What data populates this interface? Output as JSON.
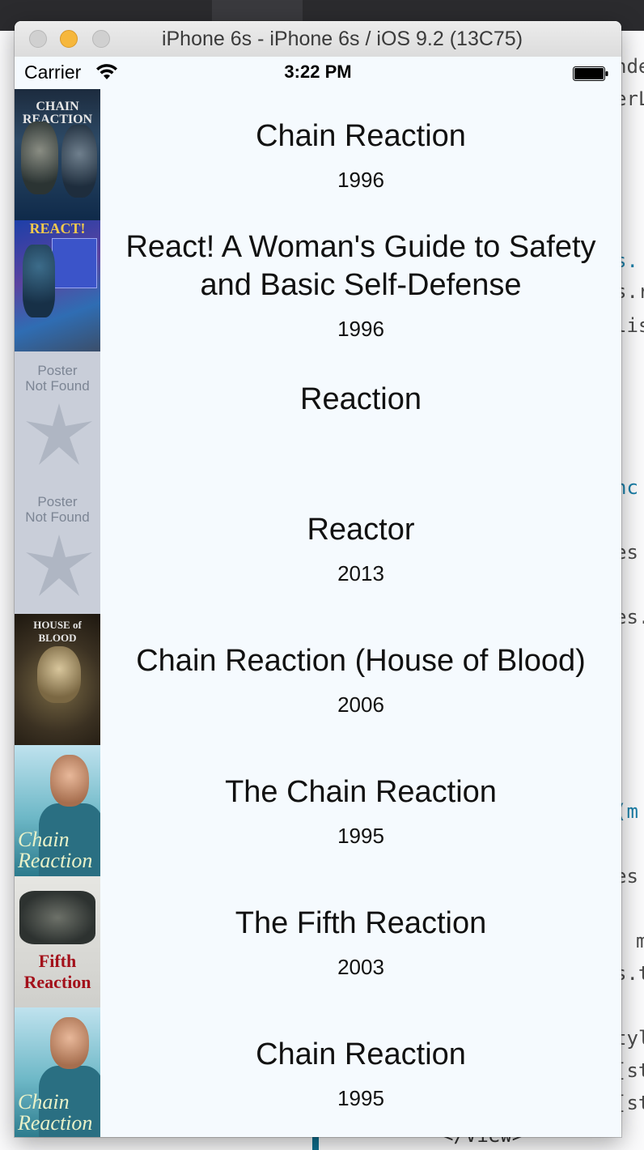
{
  "background_code": {
    "lines": [
      {
        "text": "nde",
        "color": "#4a4a4a"
      },
      {
        "text": "erL",
        "color": "#4a4a4a"
      },
      {
        "text": "s.",
        "color": "#1a7fa8"
      },
      {
        "text": "s.r",
        "color": "#4a4a4a"
      },
      {
        "text": "lis",
        "color": "#4a4a4a"
      },
      {
        "text": "nc",
        "color": "#1a7fa8"
      },
      {
        "text": "es",
        "color": "#4a4a4a"
      },
      {
        "text": "es.",
        "color": "#4a4a4a"
      },
      {
        "text": "(m",
        "color": "#1a7fa8"
      },
      {
        "text": "es",
        "color": "#4a4a4a"
      },
      {
        "text": "m",
        "color": "#4a4a4a"
      },
      {
        "text": "s.t",
        "color": "#4a4a4a"
      },
      {
        "text": "tyl",
        "color": "#4a4a4a"
      },
      {
        "text": "[st",
        "color": "#4a4a4a"
      },
      {
        "text": "[st",
        "color": "#4a4a4a"
      }
    ],
    "tail": "</View>"
  },
  "window": {
    "title": "iPhone 6s - iPhone 6s / iOS 9.2 (13C75)"
  },
  "statusbar": {
    "carrier": "Carrier",
    "time": "3:22 PM"
  },
  "poster_placeholder": {
    "line1": "Poster",
    "line2": "Not Found"
  },
  "movies": [
    {
      "title": "Chain Reaction",
      "year": "1996",
      "poster": "chain-reaction-poster"
    },
    {
      "title": "React! A Woman's Guide to Safety and Basic Self-Defense",
      "year": "1996",
      "poster": "react-poster"
    },
    {
      "title": "Reaction",
      "year": "",
      "poster": "poster-not-found"
    },
    {
      "title": "Reactor",
      "year": "2013",
      "poster": "poster-not-found"
    },
    {
      "title": "Chain Reaction (House of Blood)",
      "year": "2006",
      "poster": "house-of-blood-poster"
    },
    {
      "title": "The Chain Reaction",
      "year": "1995",
      "poster": "chain-reaction-teen-poster"
    },
    {
      "title": "The Fifth Reaction",
      "year": "2003",
      "poster": "fifth-reaction-poster"
    },
    {
      "title": "Chain Reaction",
      "year": "1995",
      "poster": "chain-reaction-teen-poster"
    }
  ],
  "poster_text": {
    "chain": "CHAIN REACTION",
    "react": "REACT!",
    "blood": "HOUSE of BLOOD",
    "teen_script": "Chain Reaction",
    "fifth": "Fifth Reaction"
  }
}
